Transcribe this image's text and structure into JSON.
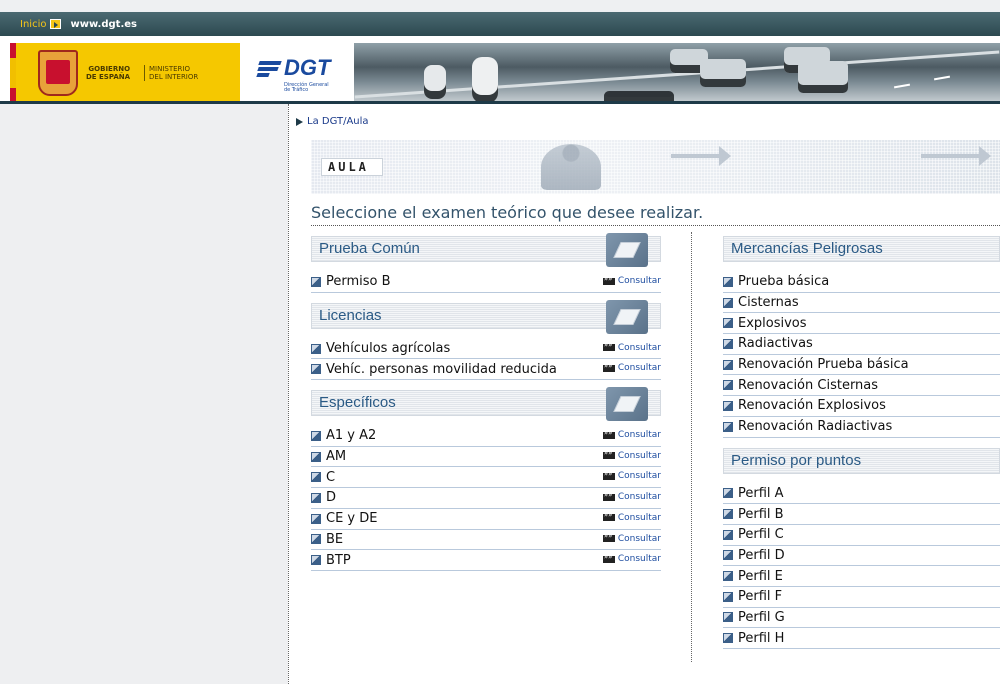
{
  "topbar": {
    "home_label": "Inicio",
    "site_url": "www.dgt.es"
  },
  "banner": {
    "gobierno": "GOBIERNO\nDE ESPAÑA",
    "ministerio": "MINISTERIO\nDEL INTERIOR",
    "dgt_logo": "DGT",
    "dgt_sub": "Dirección General\nde Tráfico"
  },
  "breadcrumb": "La DGT/Aula",
  "aula_logo": "AULA",
  "headline": "Seleccione el examen teórico que desee realizar.",
  "consult_label": "Consultar",
  "left_sections": [
    {
      "title": "Prueba Común",
      "items": [
        "Permiso B"
      ]
    },
    {
      "title": "Licencias",
      "items": [
        "Vehículos agrícolas",
        "Vehíc. personas movilidad reducida"
      ]
    },
    {
      "title": "Específicos",
      "items": [
        "A1 y A2",
        "AM",
        "C",
        "D",
        "CE y DE",
        "BE",
        "BTP"
      ]
    }
  ],
  "right_sections": [
    {
      "title": "Mercancías Peligrosas",
      "items": [
        "Prueba básica",
        "Cisternas",
        "Explosivos",
        "Radiactivas",
        "Renovación Prueba básica",
        "Renovación Cisternas",
        "Renovación Explosivos",
        "Renovación Radiactivas"
      ]
    },
    {
      "title": "Permiso por puntos",
      "items": [
        "Perfil A",
        "Perfil B",
        "Perfil C",
        "Perfil D",
        "Perfil E",
        "Perfil F",
        "Perfil G",
        "Perfil H"
      ]
    }
  ],
  "colors": {
    "topbar": "#2c4950",
    "link": "#1f4ea0",
    "section_title": "#2a5a85",
    "gobierno_bg": "#f5c800",
    "dgt_blue": "#1a4a9e"
  }
}
